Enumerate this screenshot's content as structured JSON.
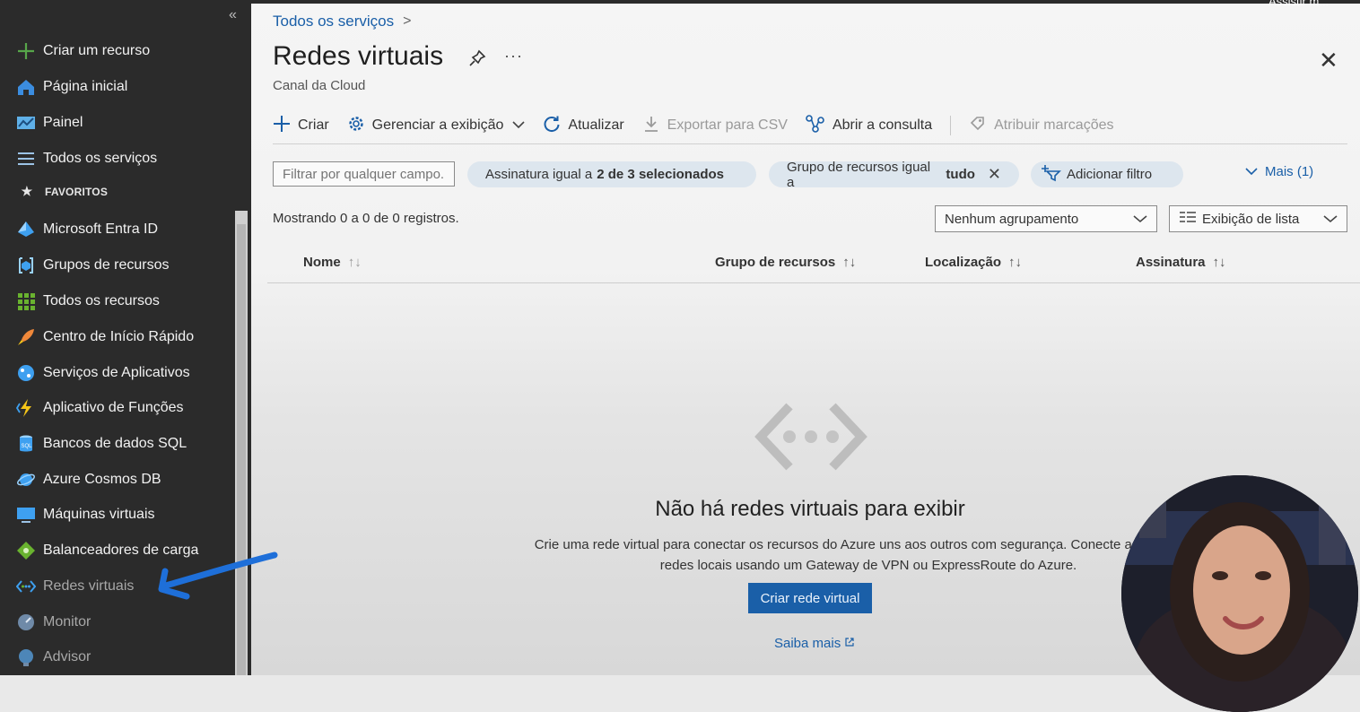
{
  "sidebar": {
    "collapse_label": "«",
    "favorites_label": "FAVORITOS",
    "items": [
      {
        "label": "Criar um recurso",
        "icon": "plus-icon",
        "color": "#57a64a"
      },
      {
        "label": "Página inicial",
        "icon": "home-icon",
        "color": "#3b8de0"
      },
      {
        "label": "Painel",
        "icon": "dashboard-icon",
        "color": "#5fb0e8"
      },
      {
        "label": "Todos os serviços",
        "icon": "list-icon",
        "color": "#9cc3e6"
      },
      {
        "label": "Microsoft Entra ID",
        "icon": "entra-id-icon",
        "color": "#3ea0f0"
      },
      {
        "label": "Grupos de recursos",
        "icon": "resource-groups-icon",
        "color": "#3ea0f0"
      },
      {
        "label": "Todos os recursos",
        "icon": "grid-icon",
        "color": "#69b32f"
      },
      {
        "label": "Centro de Início Rápido",
        "icon": "rocket-icon",
        "color": "#f0883a"
      },
      {
        "label": "Serviços de Aplicativos",
        "icon": "app-services-icon",
        "color": "#3ea0f0"
      },
      {
        "label": "Aplicativo de Funções",
        "icon": "function-app-icon",
        "color": "#f5c518"
      },
      {
        "label": "Bancos de dados SQL",
        "icon": "sql-database-icon",
        "color": "#3ea0f0"
      },
      {
        "label": "Azure Cosmos DB",
        "icon": "cosmos-db-icon",
        "color": "#3ea0f0"
      },
      {
        "label": "Máquinas virtuais",
        "icon": "virtual-machine-icon",
        "color": "#3ea0f0"
      },
      {
        "label": "Balanceadores de carga",
        "icon": "load-balancer-icon",
        "color": "#69b32f"
      },
      {
        "label": "Redes virtuais",
        "icon": "virtual-network-icon",
        "color": "#3ea0f0"
      },
      {
        "label": "Monitor",
        "icon": "monitor-icon",
        "color": "#3ea0f0"
      },
      {
        "label": "Advisor",
        "icon": "advisor-icon",
        "color": "#3ea0f0"
      }
    ]
  },
  "breadcrumb": {
    "root": "Todos os serviços",
    "separator": ">"
  },
  "header": {
    "title": "Redes virtuais",
    "subtitle": "Canal da Cloud",
    "more": "···",
    "close": "✕"
  },
  "toolbar": {
    "create": "Criar",
    "manage_view": "Gerenciar a exibição",
    "refresh": "Atualizar",
    "export_csv": "Exportar para CSV",
    "open_query": "Abrir a consulta",
    "assign_tags": "Atribuir marcações"
  },
  "filters": {
    "search_placeholder": "Filtrar por qualquer campo...",
    "subscription_prefix": "Assinatura igual a",
    "subscription_value": "2 de 3 selecionados",
    "resource_group_prefix": "Grupo de recursos igual a",
    "resource_group_value": "tudo",
    "add_filter": "Adicionar filtro",
    "more": "Mais (1)"
  },
  "results": {
    "showing": "Mostrando 0 a 0 de 0 registros.",
    "grouping": "Nenhum agrupamento",
    "view": "Exibição de lista"
  },
  "table": {
    "columns": [
      "Nome",
      "Grupo de recursos",
      "Localização",
      "Assinatura"
    ],
    "sort_glyph": "↑↓"
  },
  "empty_state": {
    "title": "Não há redes virtuais para exibir",
    "line1": "Crie uma rede virtual para conectar os recursos do Azure uns aos outros com segurança. Conecte a rede virtual",
    "line2": "redes locais usando um Gateway de VPN ou ExpressRoute do Azure.",
    "create_button": "Criar rede virtual",
    "learn_more": "Saiba mais"
  },
  "overlay": {
    "watch_label": "Assistir m..."
  },
  "colors": {
    "sidebar_bg": "#2b2b2b",
    "accent": "#1a5fa8",
    "pill_bg": "#dde6ee",
    "annotation_arrow": "#1e6fd9"
  }
}
